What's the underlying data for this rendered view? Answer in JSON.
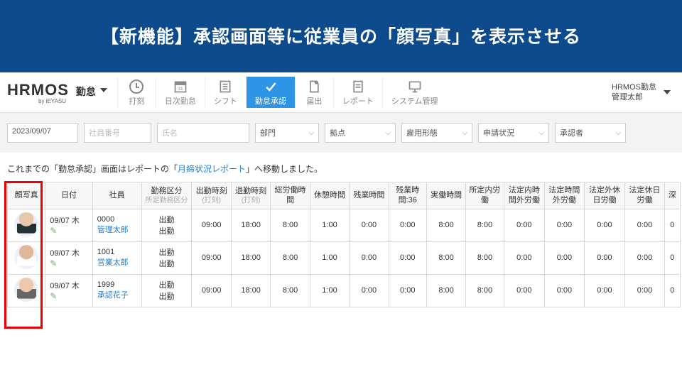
{
  "banner": {
    "text": "【新機能】承認画面等に従業員の「顔写真」を表示させる"
  },
  "brand": {
    "main": "HRMOS",
    "sub": "勤怠",
    "mini": "by iEYASU"
  },
  "nav": [
    {
      "label": "打刻",
      "name": "nav-stamp"
    },
    {
      "label": "日次勤怠",
      "name": "nav-daily"
    },
    {
      "label": "シフト",
      "name": "nav-shift"
    },
    {
      "label": "勤怠承認",
      "name": "nav-approve",
      "active": true
    },
    {
      "label": "届出",
      "name": "nav-request"
    },
    {
      "label": "レポート",
      "name": "nav-report"
    },
    {
      "label": "システム管理",
      "name": "nav-admin"
    }
  ],
  "user": {
    "line1": "HRMOS勤怠",
    "line2": "管理太郎"
  },
  "filters": {
    "date": "2023/09/07",
    "emp_no_placeholder": "社員番号",
    "name_placeholder": "氏名",
    "dept": "部門",
    "site": "拠点",
    "employment": "雇用形態",
    "apply_status": "申請状況",
    "approver": "承認者"
  },
  "notice": {
    "pre": "これまでの「勤怠承認」画面はレポートの「",
    "link": "月締状況レポート",
    "post": "」へ移動しました。"
  },
  "columns": {
    "photo": "顔写真",
    "date": "日付",
    "emp": "社員",
    "worktype": "勤務区分",
    "worktype_sub": "所定勤務区分",
    "in": "出勤時刻",
    "in_sub": "(打刻)",
    "out": "退勤時刻",
    "out_sub": "(打刻)",
    "total": "総労働時間",
    "break": "休憩時間",
    "overtime": "残業時間",
    "overtime36": "残業時間:36",
    "actual": "実働時間",
    "in_sched": "所定内労働",
    "out_sched": "法定内時間外労働",
    "legal_over": "法定時間外労働",
    "legal_holiday_out": "法定外休日労働",
    "legal_holiday": "法定休日労働",
    "late": "深"
  },
  "rows": [
    {
      "avatar": "a1",
      "date": "09/07 木",
      "emp_no": "0000",
      "emp_name": "管理太郎",
      "wt1": "出勤",
      "wt2": "出勤",
      "in": "09:00",
      "out": "18:00",
      "total": "8:00",
      "break": "1:00",
      "ot": "0:00",
      "ot36": "0:00",
      "act": "8:00",
      "sin": "8:00",
      "sout": "0:00",
      "lover": "0:00",
      "lhout": "0:00",
      "lhol": "0:00",
      "late": "0"
    },
    {
      "avatar": "a2",
      "date": "09/07 木",
      "emp_no": "1001",
      "emp_name": "営業太郎",
      "wt1": "出勤",
      "wt2": "出勤",
      "in": "09:00",
      "out": "18:00",
      "total": "8:00",
      "break": "1:00",
      "ot": "0:00",
      "ot36": "0:00",
      "act": "8:00",
      "sin": "8:00",
      "sout": "0:00",
      "lover": "0:00",
      "lhout": "0:00",
      "lhol": "0:00",
      "late": "0"
    },
    {
      "avatar": "a3",
      "date": "09/07 木",
      "emp_no": "1999",
      "emp_name": "承認花子",
      "wt1": "出勤",
      "wt2": "出勤",
      "in": "09:00",
      "out": "18:00",
      "total": "8:00",
      "break": "1:00",
      "ot": "0:00",
      "ot36": "0:00",
      "act": "8:00",
      "sin": "8:00",
      "sout": "0:00",
      "lover": "0:00",
      "lhout": "0:00",
      "lhol": "0:00",
      "late": "0"
    }
  ]
}
